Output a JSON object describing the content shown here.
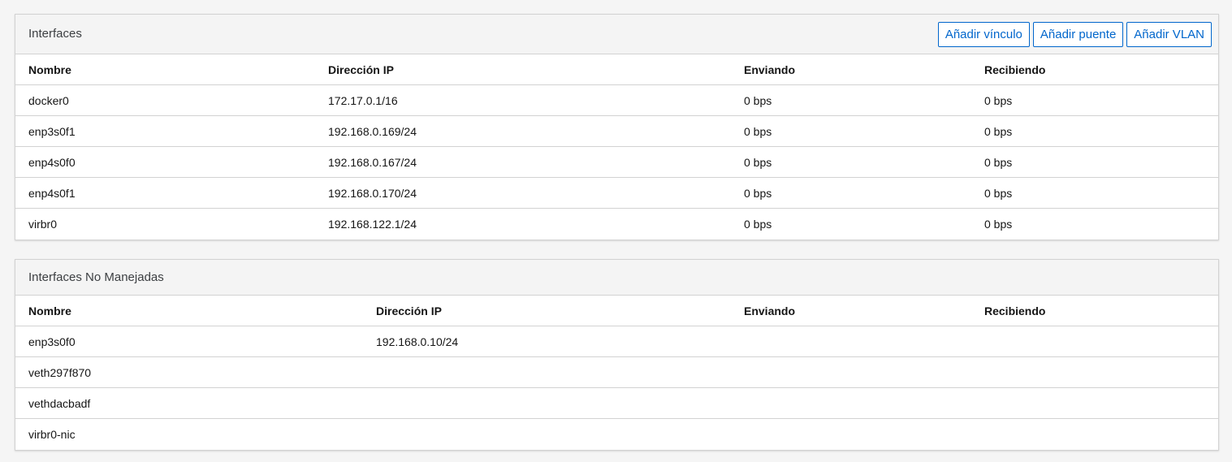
{
  "interfaces_panel": {
    "title": "Interfaces",
    "buttons": {
      "add_bond": "Añadir vínculo",
      "add_bridge": "Añadir puente",
      "add_vlan": "Añadir VLAN"
    },
    "columns": [
      "Nombre",
      "Dirección IP",
      "Enviando",
      "Recibiendo"
    ],
    "rows": [
      {
        "name": "docker0",
        "ip": "172.17.0.1/16",
        "sending": "0 bps",
        "receiving": "0 bps"
      },
      {
        "name": "enp3s0f1",
        "ip": "192.168.0.169/24",
        "sending": "0 bps",
        "receiving": "0 bps"
      },
      {
        "name": "enp4s0f0",
        "ip": "192.168.0.167/24",
        "sending": "0 bps",
        "receiving": "0 bps"
      },
      {
        "name": "enp4s0f1",
        "ip": "192.168.0.170/24",
        "sending": "0 bps",
        "receiving": "0 bps"
      },
      {
        "name": "virbr0",
        "ip": "192.168.122.1/24",
        "sending": "0 bps",
        "receiving": "0 bps"
      }
    ]
  },
  "unmanaged_panel": {
    "title": "Interfaces No Manejadas",
    "columns": [
      "Nombre",
      "Dirección IP",
      "Enviando",
      "Recibiendo"
    ],
    "rows": [
      {
        "name": "enp3s0f0",
        "ip": "192.168.0.10/24",
        "sending": "",
        "receiving": ""
      },
      {
        "name": "veth297f870",
        "ip": "",
        "sending": "",
        "receiving": ""
      },
      {
        "name": "vethdacbadf",
        "ip": "",
        "sending": "",
        "receiving": ""
      },
      {
        "name": "virbr0-nic",
        "ip": "",
        "sending": "",
        "receiving": ""
      }
    ]
  },
  "colors": {
    "accent": "#0066cc",
    "background": "#f5f5f5",
    "header_background": "#f4f4f4",
    "border": "#d2d2d2"
  }
}
